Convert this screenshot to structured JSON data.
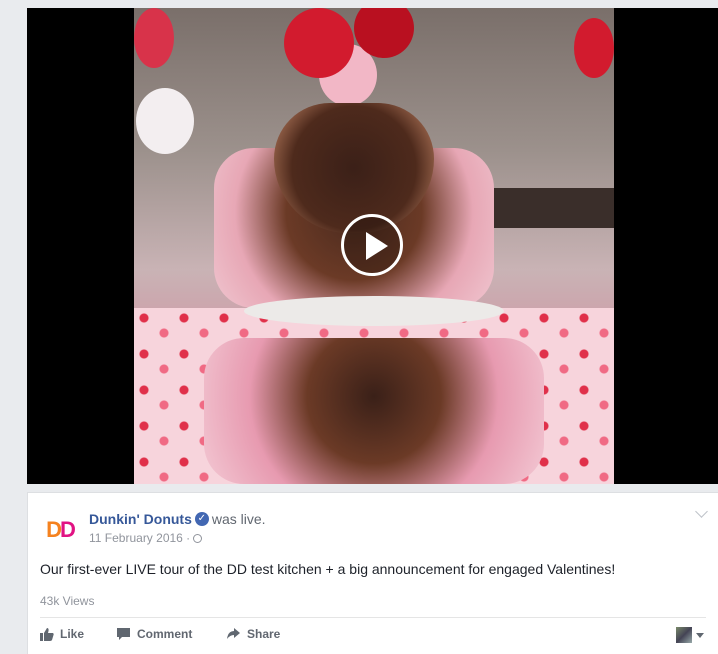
{
  "video": {
    "play_icon": "play-icon"
  },
  "post": {
    "page_name": "Dunkin' Donuts",
    "verified_icon": "verified-badge-icon",
    "status_text": "was live.",
    "date": "11 February 2016 ·",
    "privacy_icon": "globe-icon",
    "logo_letters": "DD",
    "message": "Our first-ever LIVE tour of the DD test kitchen + a big announcement for engaged Valentines!",
    "views": "43k Views",
    "menu_icon": "chevron-down-icon"
  },
  "actions": {
    "like_label": "Like",
    "comment_label": "Comment",
    "share_label": "Share",
    "like_icon": "thumbs-up-icon",
    "comment_icon": "comment-icon",
    "share_icon": "share-arrow-icon"
  },
  "colors": {
    "link": "#365899",
    "muted": "#90949c",
    "verified": "#4267b2",
    "brand_orange": "#f5821f",
    "brand_pink": "#e11383"
  }
}
